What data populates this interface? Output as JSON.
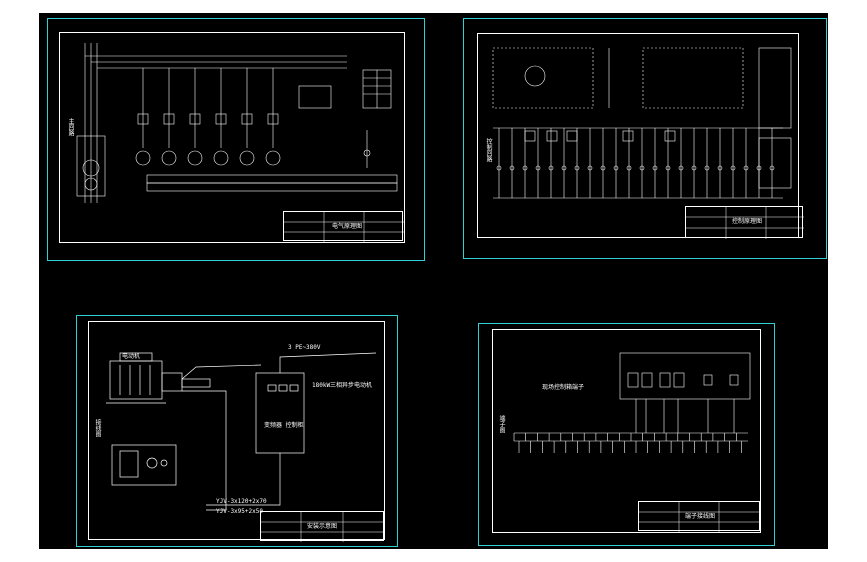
{
  "app": {
    "background": "#000000",
    "frame_color": "#2fd1d4",
    "line_color": "#ffffff"
  },
  "sheets": [
    {
      "id": "sheet-1",
      "labels": {
        "side": "主回路",
        "title_block": "电气原理图"
      }
    },
    {
      "id": "sheet-2",
      "labels": {
        "side": "控制回路",
        "title_block": "控制原理图"
      }
    },
    {
      "id": "sheet-3",
      "labels": {
        "motor": "电动机",
        "power": "3 PE~380V",
        "vfd_box": "变频器\n控制柜",
        "note": "180kW三相异步电动机",
        "cable_1": "YJV-3x120+2x70",
        "cable_2": "YJV-3x95+2x50",
        "side": "接线图",
        "title_block": "安装示意图"
      }
    },
    {
      "id": "sheet-4",
      "labels": {
        "heading": "现场控制箱端子",
        "side": "端子图",
        "title_block": "端子接线图"
      }
    }
  ]
}
